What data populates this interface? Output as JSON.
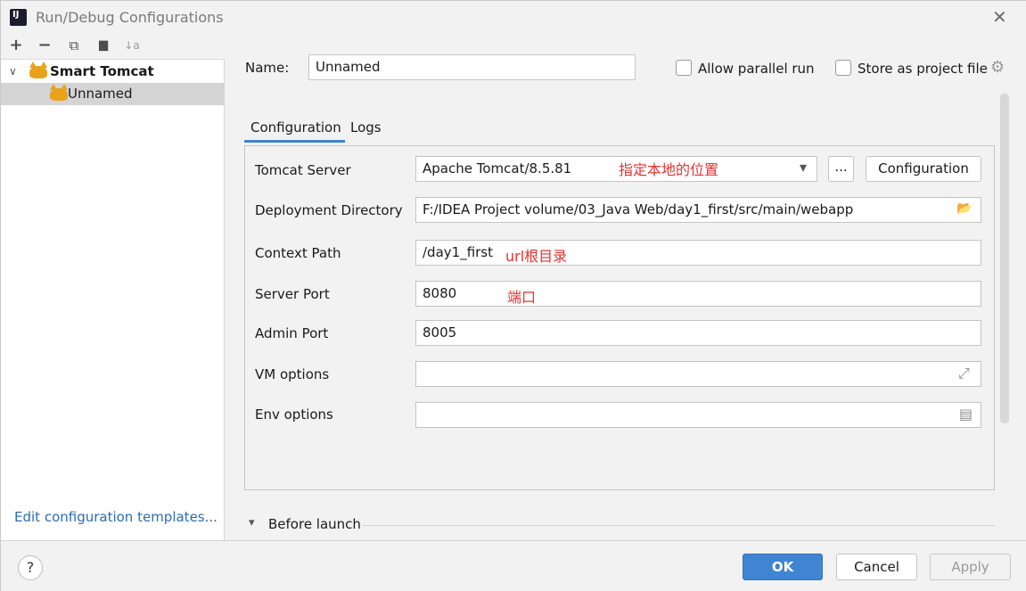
{
  "window": {
    "title": "Run/Debug Configurations",
    "app_icon_text": "IJ"
  },
  "toolbar": {
    "add_icon": "+",
    "remove_icon": "−",
    "copy_icon": "⧉",
    "folder_icon": "▆",
    "sort_icon": "↓a"
  },
  "tree": {
    "group_arrow": "∨",
    "group_label": "Smart Tomcat",
    "item_label": "Unnamed"
  },
  "edit_templates_link": "Edit configuration templates...",
  "name_field": {
    "label": "Name:",
    "value": "Unnamed"
  },
  "options": {
    "allow_parallel_label": "Allow parallel run",
    "store_as_project_label": "Store as project file",
    "gear_icon": "⚙"
  },
  "tabs": [
    {
      "label": "Configuration"
    },
    {
      "label": "Logs"
    }
  ],
  "form": {
    "tomcat_server": {
      "label": "Tomcat Server",
      "value": "Apache Tomcat/8.5.81",
      "dropdown_icon": "▾",
      "ellipsis_label": "...",
      "config_button_label": "Configuration",
      "annotation": "指定本地的位置"
    },
    "deployment_directory": {
      "label": "Deployment Directory",
      "value": "F:/IDEA Project volume/03_Java Web/day1_first/src/main/webapp",
      "folder_icon": "📂"
    },
    "context_path": {
      "label": "Context Path",
      "value": "/day1_first",
      "annotation": "url根目录"
    },
    "server_port": {
      "label": "Server Port",
      "value": "8080",
      "annotation": "端口"
    },
    "admin_port": {
      "label": "Admin Port",
      "value": "8005"
    },
    "vm_options": {
      "label": "VM options",
      "value": "",
      "expand_icon": "⤢"
    },
    "env_options": {
      "label": "Env options",
      "value": "",
      "doc_icon": "▤"
    }
  },
  "before_launch": {
    "arrow": "▾",
    "label": "Before launch"
  },
  "buttons": {
    "help": "?",
    "ok": "OK",
    "cancel": "Cancel",
    "apply": "Apply"
  },
  "colors": {
    "accent": "#3f85d3",
    "link": "#2e6bb3",
    "annotation": "#e53333",
    "tab_underline": "#4083c9"
  }
}
